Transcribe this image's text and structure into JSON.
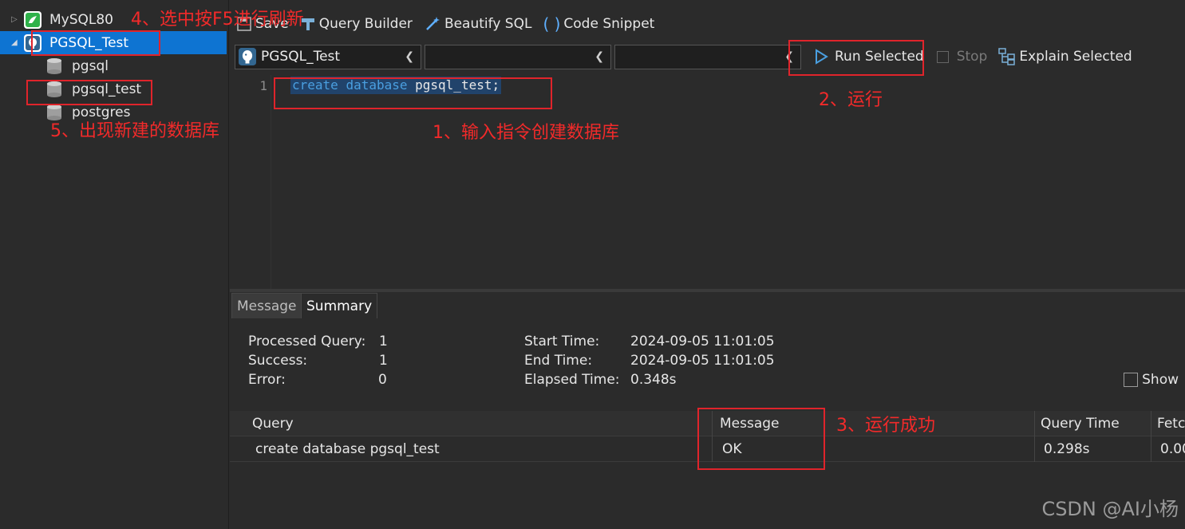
{
  "sidebar": {
    "connections": [
      {
        "label": "MySQL80",
        "icon": "mysql-icon"
      },
      {
        "label": "PGSQL_Test",
        "icon": "postgresql-icon"
      }
    ],
    "databases": [
      {
        "label": "pgsql"
      },
      {
        "label": "pgsql_test"
      },
      {
        "label": "postgres"
      }
    ]
  },
  "toolbar": {
    "save_label": "Save",
    "query_builder_label": "Query Builder",
    "beautify_label": "Beautify SQL",
    "snippet_label": "Code Snippet",
    "connection_value": "PGSQL_Test",
    "database_value": "",
    "schema_value": "",
    "run_label": "Run Selected",
    "stop_label": "Stop",
    "explain_label": "Explain Selected"
  },
  "editor": {
    "line_number": "1",
    "code_keyword1": "create",
    "code_keyword2": "database",
    "code_ident": "pgsql_test;"
  },
  "tabs": [
    {
      "label": "Message",
      "active": false
    },
    {
      "label": "Summary",
      "active": true
    }
  ],
  "summary": {
    "processed_label": "Processed Query:",
    "processed_value": "1",
    "success_label": "Success:",
    "success_value": "1",
    "error_label": "Error:",
    "error_value": "0",
    "start_label": "Start Time:",
    "start_value": "2024-09-05 11:01:05",
    "end_label": "End Time:",
    "end_value": "2024-09-05 11:01:05",
    "elapsed_label": "Elapsed Time:",
    "elapsed_value": "0.348s",
    "show_label": "Show"
  },
  "grid": {
    "columns": [
      "Query",
      "Message",
      "Query Time",
      "Fetc"
    ],
    "rows": [
      {
        "query": "create database pgsql_test",
        "message": "OK",
        "time": "0.298s",
        "fetch": "0.00"
      }
    ]
  },
  "annotations": {
    "a1": "1、输入指令创建数据库",
    "a2": "2、运行",
    "a3": "3、运行成功",
    "a4": "4、选中按F5进行刷新",
    "a5": "5、出现新建的数据库"
  },
  "watermark": "CSDN @AI小杨",
  "colors": {
    "selection": "#0e74d2",
    "annotation_red": "#e0242b",
    "keyword_blue": "#4a9fe0",
    "code_highlight": "#21436b"
  }
}
